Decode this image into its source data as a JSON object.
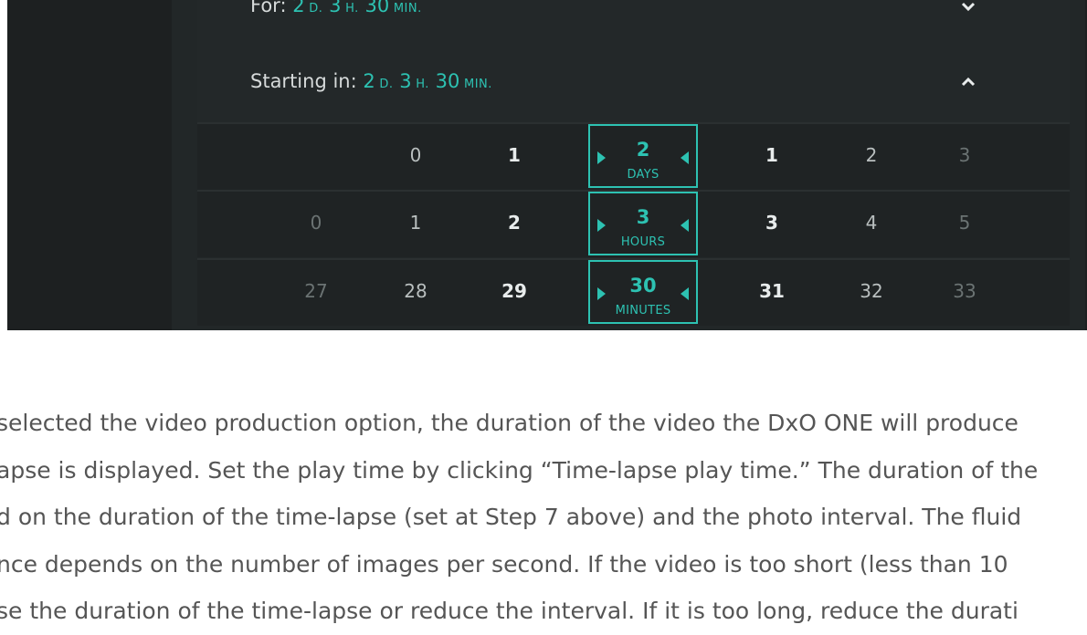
{
  "panel": {
    "for_row": {
      "label": "For:",
      "days": "2",
      "d_unit": "D.",
      "hours": "3",
      "h_unit": "H.",
      "minutes": "30",
      "min_unit": "MIN."
    },
    "starting_row": {
      "label": "Starting in:",
      "days": "2",
      "d_unit": "D.",
      "hours": "3",
      "h_unit": "H.",
      "minutes": "30",
      "min_unit": "MIN."
    },
    "pickers": [
      {
        "unit": "DAYS",
        "before": [
          "",
          "0",
          "1"
        ],
        "selected": "2",
        "after": [
          "1",
          "2",
          "3"
        ]
      },
      {
        "unit": "HOURS",
        "before": [
          "0",
          "1",
          "2"
        ],
        "selected": "3",
        "after": [
          "3",
          "4",
          "5"
        ]
      },
      {
        "unit": "MINUTES",
        "before": [
          "27",
          "28",
          "29"
        ],
        "selected": "30",
        "after": [
          "31",
          "32",
          "33"
        ]
      }
    ]
  },
  "body_text": [
    "selected the video production option, the duration of the video the DxO ONE will produce",
    "apse is displayed. Set the play time by clicking “Time-lapse play time.” The duration of the",
    "d on the duration of the time-lapse (set at Step 7 above) and the photo interval. The fluid",
    "nce depends on the number of images per second. If the video is too short (less than 10",
    "se the duration of the time-lapse or reduce the interval. If it is too long, reduce the durati"
  ],
  "colors": {
    "accent": "#2dc2b2",
    "panel_bg": "#222728",
    "outer_bg": "#1d2021"
  },
  "icons": {
    "collapse": "chevron-down-icon",
    "expand": "chevron-up-icon",
    "increment": "triangle-right-icon",
    "decrement": "triangle-left-icon"
  }
}
